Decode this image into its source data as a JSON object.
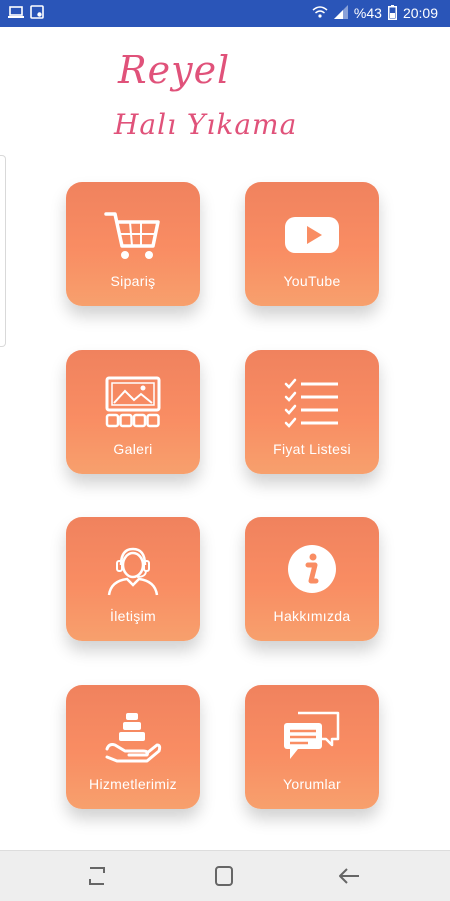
{
  "status_bar": {
    "battery_text": "%43",
    "time": "20:09"
  },
  "logo": {
    "line1": "Reyel",
    "line2": "Halı Yıkama"
  },
  "menu": {
    "items": [
      {
        "label": "Sipariş",
        "icon": "cart-icon"
      },
      {
        "label": "YouTube",
        "icon": "youtube-icon"
      },
      {
        "label": "Galeri",
        "icon": "gallery-icon"
      },
      {
        "label": "Fiyat Listesi",
        "icon": "checklist-icon"
      },
      {
        "label": "İletişim",
        "icon": "headset-icon"
      },
      {
        "label": "Hakkımızda",
        "icon": "info-icon"
      },
      {
        "label": "Hizmetlerimiz",
        "icon": "hand-service-icon"
      },
      {
        "label": "Yorumlar",
        "icon": "chat-bubbles-icon"
      }
    ]
  },
  "nav_bar": {
    "buttons": [
      "recent-apps-icon",
      "home-icon",
      "back-icon"
    ]
  },
  "colors": {
    "status_bar": "#2a55b8",
    "tile_top": "#f0825e",
    "tile_bottom": "#f7a06d",
    "logo": "#e0527a",
    "nav_bar": "#eeeeee"
  }
}
